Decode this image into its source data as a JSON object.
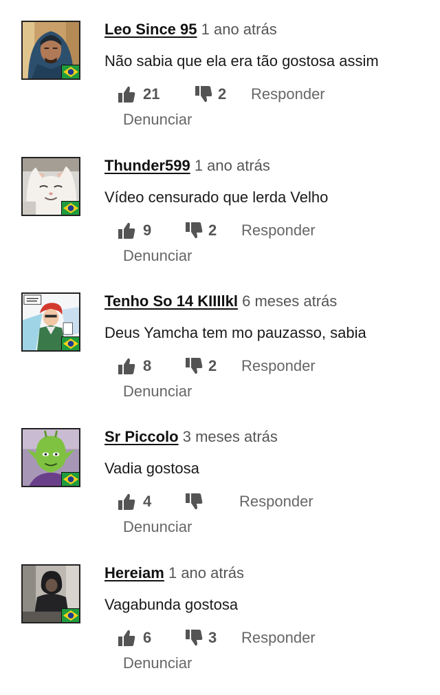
{
  "comments": [
    {
      "username": "Leo Since 95",
      "time": "1 ano atrás",
      "text": "Não sabia que ela era tão gostosa assim",
      "likes": "21",
      "dislikes": "2",
      "reply_label": "Responder",
      "report_label": "Denunciar",
      "avatar": "man-in-hoodie-photo",
      "flag": "brazil-flag-icon"
    },
    {
      "username": "Thunder599",
      "time": "1 ano atrás",
      "text": "Vídeo censurado que lerda Velho",
      "likes": "9",
      "dislikes": "2",
      "reply_label": "Responder",
      "report_label": "Denunciar",
      "avatar": "smiling-cat-photo",
      "flag": "brazil-flag-icon"
    },
    {
      "username": "Tenho So 14 KIIIlkl",
      "time": "6 meses atrás",
      "text": "Deus Yamcha tem mo pauzasso, sabia",
      "likes": "8",
      "dislikes": "2",
      "reply_label": "Responder",
      "report_label": "Denunciar",
      "avatar": "anime-character-drawing",
      "flag": "brazil-flag-icon"
    },
    {
      "username": "Sr Piccolo",
      "time": "3 meses atrás",
      "text": "Vadia gostosa",
      "likes": "4",
      "dislikes": "",
      "reply_label": "Responder",
      "report_label": "Denunciar",
      "avatar": "green-alien-character",
      "flag": "brazil-flag-icon"
    },
    {
      "username": "Hereiam",
      "time": "1 ano atrás",
      "text": "Vagabunda gostosa",
      "likes": "6",
      "dislikes": "3",
      "reply_label": "Responder",
      "report_label": "Denunciar",
      "avatar": "hooded-figure-photo",
      "flag": "brazil-flag-icon"
    }
  ],
  "colors": {
    "icon": "#545454",
    "username": "#111111",
    "meta": "#555555",
    "flag_green": "#1f9c3e",
    "flag_yellow": "#f2d11b",
    "flag_blue": "#1c3d8f"
  }
}
